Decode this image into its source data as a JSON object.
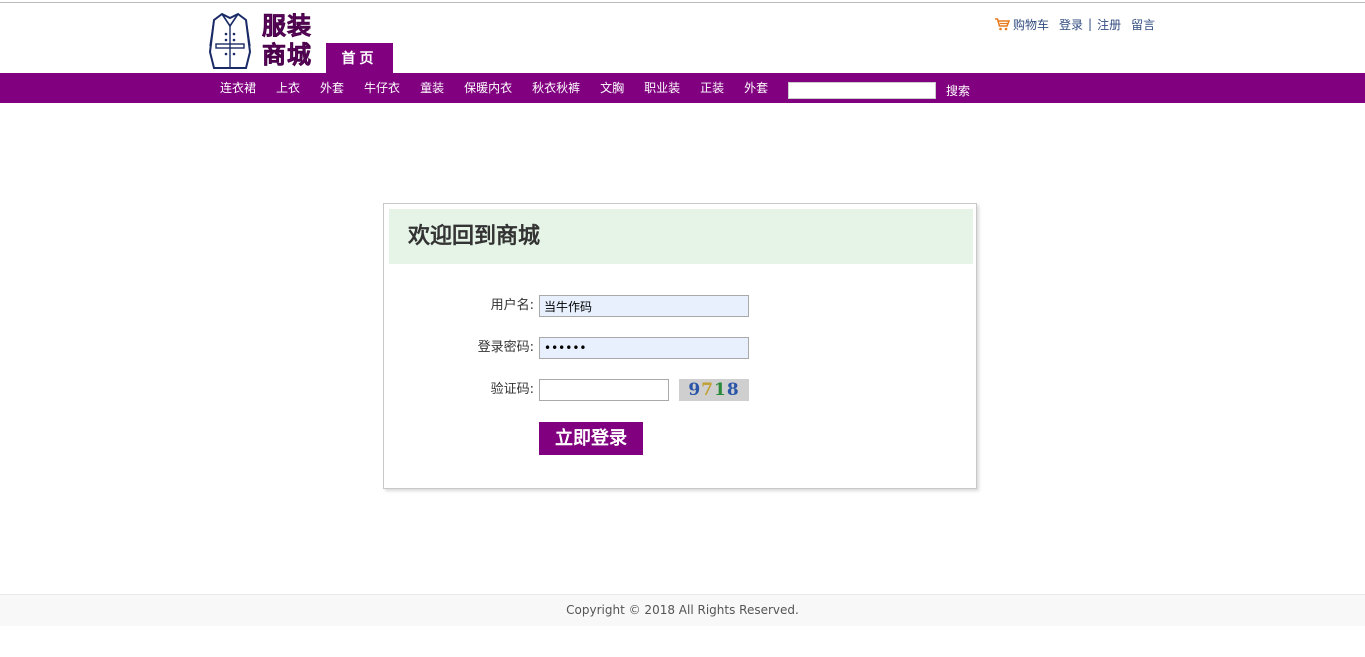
{
  "header": {
    "brand": "服装商城",
    "home_tab": "首页",
    "links": {
      "cart": "购物车",
      "login": "登录",
      "separator": "|",
      "register": "注册",
      "message": "留言"
    }
  },
  "nav": {
    "items": [
      "连衣裙",
      "上衣",
      "外套",
      "牛仔衣",
      "童装",
      "保暖内衣",
      "秋衣秋裤",
      "文胸",
      "职业装",
      "正装",
      "外套"
    ],
    "search_value": "",
    "search_button": "搜索"
  },
  "login": {
    "title": "欢迎回到商城",
    "username_label": "用户名:",
    "username_value": "当牛作码",
    "password_label": "登录密码:",
    "password_value": "••••••",
    "captcha_label": "验证码:",
    "captcha_value": "",
    "captcha_image_text": "9718",
    "submit": "立即登录"
  },
  "footer": {
    "copyright": "Copyright © 2018 All Rights Reserved."
  },
  "colors": {
    "brand_purple": "#800080",
    "panel_header_bg": "#e6f4e8",
    "link_blue": "#334d80"
  }
}
